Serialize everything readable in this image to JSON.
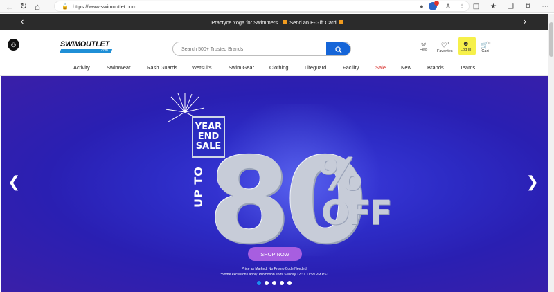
{
  "browser": {
    "url": "https://www.swimoutlet.com"
  },
  "promo": {
    "text": "Practyce Yoga for Swimmers",
    "link": "Send an E-Gift Card"
  },
  "header": {
    "logo": "SWIMOUTLET",
    "logo_sub": ".com",
    "search_placeholder": "Search 500+ Trusted Brands",
    "help": "Help",
    "favorites": "Favorites",
    "favorites_count": "0",
    "login": "Log In",
    "cart": "Cart",
    "cart_count": "0"
  },
  "nav": [
    {
      "label": "Activity"
    },
    {
      "label": "Swimwear"
    },
    {
      "label": "Rash Guards"
    },
    {
      "label": "Wetsuits"
    },
    {
      "label": "Swim Gear"
    },
    {
      "label": "Clothing"
    },
    {
      "label": "Lifeguard"
    },
    {
      "label": "Facility"
    },
    {
      "label": "Sale"
    },
    {
      "label": "New"
    },
    {
      "label": "Brands"
    },
    {
      "label": "Teams"
    }
  ],
  "hero": {
    "badge": [
      "YEAR",
      "END",
      "SALE"
    ],
    "up_to": "UP TO",
    "amount": "80",
    "percent": "%",
    "off": "OFF",
    "cta": "SHOP NOW",
    "fine1": "Price as Marked. No Promo Code Needed!",
    "fine2": "*Some exclusions apply. Promotion ends Sunday 12/31 11:59 PM PST",
    "slides": 5,
    "active_slide": 1
  },
  "colors": {
    "accent": "#1565d8",
    "hero_bg": "#2d2bc5",
    "cta": "#a75ee0",
    "sale": "#d8302d",
    "highlight": "#f6f04a"
  }
}
